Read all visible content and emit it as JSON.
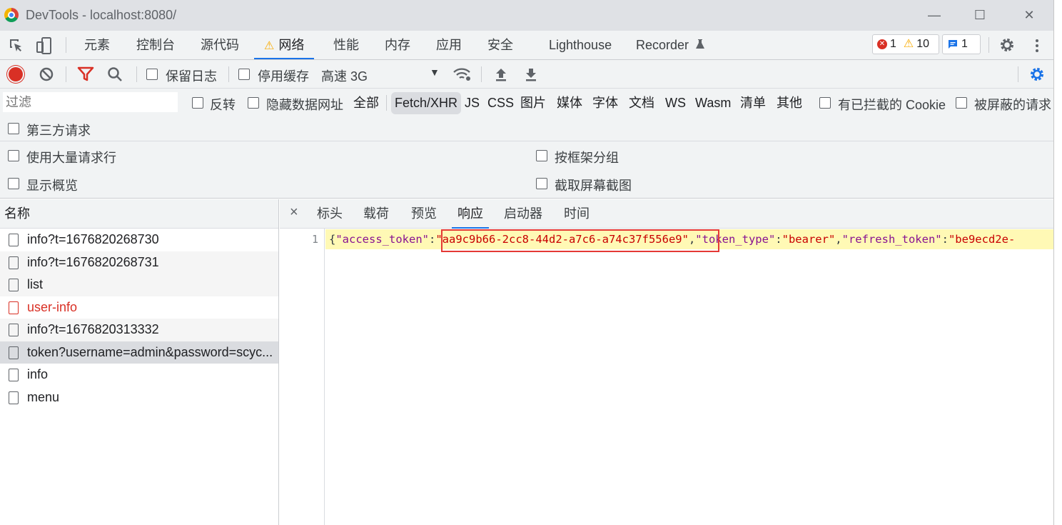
{
  "window": {
    "title": "DevTools - localhost:8080/",
    "minimize": "—",
    "maximize": "☐",
    "close": "✕"
  },
  "main_tabs": [
    {
      "label": "元素"
    },
    {
      "label": "控制台"
    },
    {
      "label": "源代码"
    },
    {
      "label": "网络",
      "active": true,
      "warning": "⚠"
    },
    {
      "label": "性能"
    },
    {
      "label": "内存"
    },
    {
      "label": "应用"
    },
    {
      "label": "安全"
    },
    {
      "label": "Lighthouse"
    },
    {
      "label": "Recorder",
      "icon": "flask-icon"
    }
  ],
  "badges": {
    "errors": "1",
    "warnings": "10",
    "messages": "1"
  },
  "toolbar": {
    "preserve_log": "保留日志",
    "disable_cache": "停用缓存",
    "throttling": "高速 3G"
  },
  "filter": {
    "placeholder": "过滤",
    "invert": "反转",
    "hide_data_urls": "隐藏数据网址",
    "types": [
      "全部",
      "Fetch/XHR",
      "JS",
      "CSS",
      "图片",
      "媒体",
      "字体",
      "文档",
      "WS",
      "Wasm",
      "清单",
      "其他"
    ],
    "active_type": "Fetch/XHR",
    "blocked_cookies": "有已拦截的 Cookie",
    "blocked_requests": "被屏蔽的请求",
    "third_party": "第三方请求"
  },
  "settings": {
    "large_rows": "使用大量请求行",
    "group_by_frame": "按框架分组",
    "overview": "显示概览",
    "screenshots": "截取屏幕截图"
  },
  "request_list": {
    "header": "名称",
    "rows": [
      {
        "name": "info?t=1676820268730"
      },
      {
        "name": "info?t=1676820268731"
      },
      {
        "name": "list"
      },
      {
        "name": "user-info",
        "error": true
      },
      {
        "name": "info?t=1676820313332"
      },
      {
        "name": "token?username=admin&password=scyc...",
        "selected": true
      },
      {
        "name": "info"
      },
      {
        "name": "menu"
      }
    ]
  },
  "detail": {
    "close": "×",
    "tabs": [
      "标头",
      "载荷",
      "预览",
      "响应",
      "启动器",
      "时间"
    ],
    "active_tab": "响应",
    "line_number": "1",
    "response": {
      "open": "{",
      "k1": "\"access_token\"",
      "v1": "\"aa9c9b66-2cc8-44d2-a7c6-a74c37f556e9\"",
      "k2": "\"token_type\"",
      "v2": "\"bearer\"",
      "k3": "\"refresh_token\"",
      "v3": "\"be9ecd2e-"
    }
  },
  "colors": {
    "accent": "#1a73e8",
    "record": "#d93025",
    "highlight": "#e53935",
    "code_bg": "#fff9b5"
  }
}
